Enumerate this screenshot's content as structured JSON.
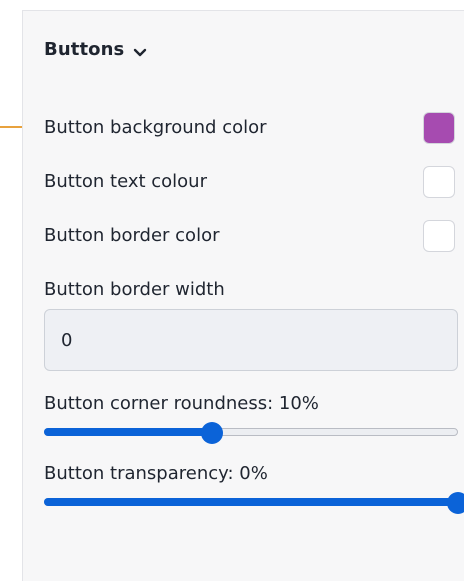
{
  "section": {
    "title": "Buttons",
    "chevron_icon": "chevron-down-icon"
  },
  "colors": {
    "callout": "#e8a23d",
    "accent": "#0b63d8"
  },
  "settings": {
    "background_color": {
      "label": "Button background color",
      "value": "#a64bb0"
    },
    "text_colour": {
      "label": "Button text colour",
      "value": "#ffffff"
    },
    "border_color": {
      "label": "Button border color",
      "value": "#ffffff"
    },
    "border_width": {
      "label": "Button border width",
      "value": "0"
    },
    "corner_roundness": {
      "label": "Button corner roundness: 10%",
      "percent": 10,
      "slider_fraction": 0.405
    },
    "transparency": {
      "label": "Button transparency: 0%",
      "percent": 0,
      "slider_fraction": 1.0
    }
  }
}
